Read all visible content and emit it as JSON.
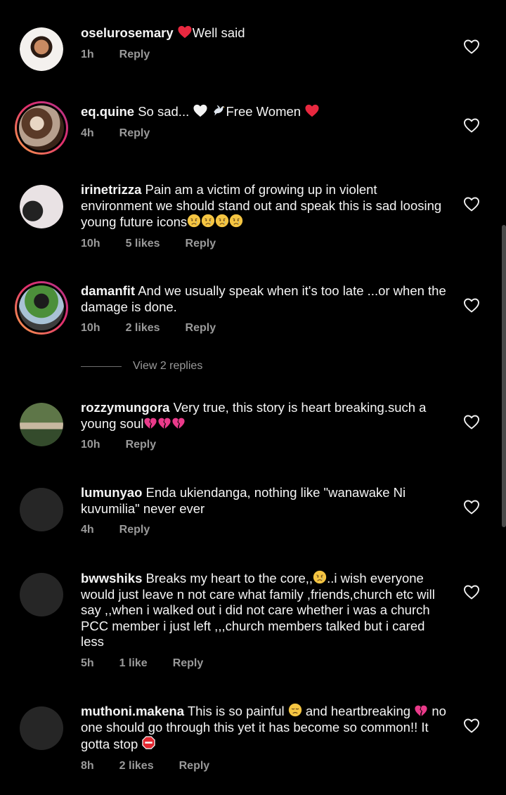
{
  "comments": [
    {
      "user": "oselurosemary",
      "text_after": "Well said",
      "time": "1h",
      "likes": "",
      "reply": "Reply"
    },
    {
      "user": "eq.quine",
      "text_a": "So sad...",
      "text_b": "Free Women",
      "time": "4h",
      "likes": "",
      "reply": "Reply"
    },
    {
      "user": "irinetrizza",
      "text": "Pain am a victim of growing up in violent environment we should stand out and speak this is sad loosing young future  icons",
      "time": "10h",
      "likes": "5 likes",
      "reply": "Reply"
    },
    {
      "user": "damanfit",
      "text": "And we usually  speak when it's too late ...or when the damage is done.",
      "time": "10h",
      "likes": "2 likes",
      "reply": "Reply"
    },
    {
      "user": "rozzymungora",
      "text": "Very true, this story is heart breaking.such a young soul",
      "time": "10h",
      "likes": "",
      "reply": "Reply"
    },
    {
      "user": "lumunyao",
      "text": "Enda ukiendanga, nothing like \"wanawake Ni kuvumilia\" never ever",
      "time": "4h",
      "likes": "",
      "reply": "Reply"
    },
    {
      "user": "bwwshiks",
      "text_a": "Breaks my heart to the core,,",
      "text_b": "..i wish everyone would just leave n not care what family ,friends,church etc will say ,,when i walked out  i did not care whether i was a church PCC member i just left ,,,church members talked but i cared less",
      "time": "5h",
      "likes": "1 like",
      "reply": "Reply"
    },
    {
      "user": "muthoni.makena",
      "text_a": "This is so painful",
      "text_b": "and heartbreaking",
      "text_c": "no one should go through this yet it has become so common!! It gotta stop",
      "time": "8h",
      "likes": "2 likes",
      "reply": "Reply"
    }
  ],
  "view_replies": "View 2 replies",
  "colors": {
    "background": "#000000",
    "meta": "#9a9a9a",
    "heart_red": "#e8283f",
    "ring": "#e1306c"
  },
  "icons": [
    "heart-outline-icon",
    "red-heart-emoji",
    "white-heart-emoji",
    "dove-emoji",
    "crying-face-emoji",
    "broken-heart-emoji",
    "disappointed-face-emoji",
    "stop-sign-emoji"
  ]
}
